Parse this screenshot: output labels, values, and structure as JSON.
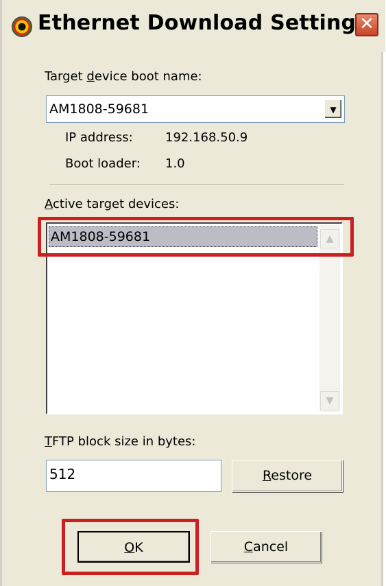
{
  "window": {
    "title": "Ethernet Download Settings",
    "close_glyph": "✕"
  },
  "boot_name": {
    "label": "Target device boot name:",
    "label_prefix": "Target ",
    "label_mnemonic": "d",
    "label_suffix": "evice boot name:",
    "value": "AM1808-59681"
  },
  "info": {
    "ip_label": "IP address:",
    "ip_value": "192.168.50.9",
    "bootloader_label": "Boot loader:",
    "bootloader_value": "1.0"
  },
  "active_devices": {
    "label_mnemonic": "A",
    "label_suffix": "ctive target devices:",
    "items": [
      "AM1808-59681"
    ],
    "selected": "AM1808-59681"
  },
  "tftp": {
    "label_mnemonic": "T",
    "label_suffix": "FTP block size in bytes:",
    "value": "512",
    "restore_mnemonic": "R",
    "restore_suffix": "estore"
  },
  "buttons": {
    "ok_mnemonic": "O",
    "ok_suffix": "K",
    "cancel_mnemonic": "C",
    "cancel_suffix": "ancel"
  },
  "colors": {
    "highlight": "#cc2020",
    "dialog_bg": "#ece9d8",
    "selection": "#bcbcc4"
  },
  "icons": {
    "app": "app-logo-icon",
    "combo_arrow": "chevron-down-icon",
    "scroll_up": "chevron-up-icon",
    "scroll_down": "chevron-down-icon"
  }
}
